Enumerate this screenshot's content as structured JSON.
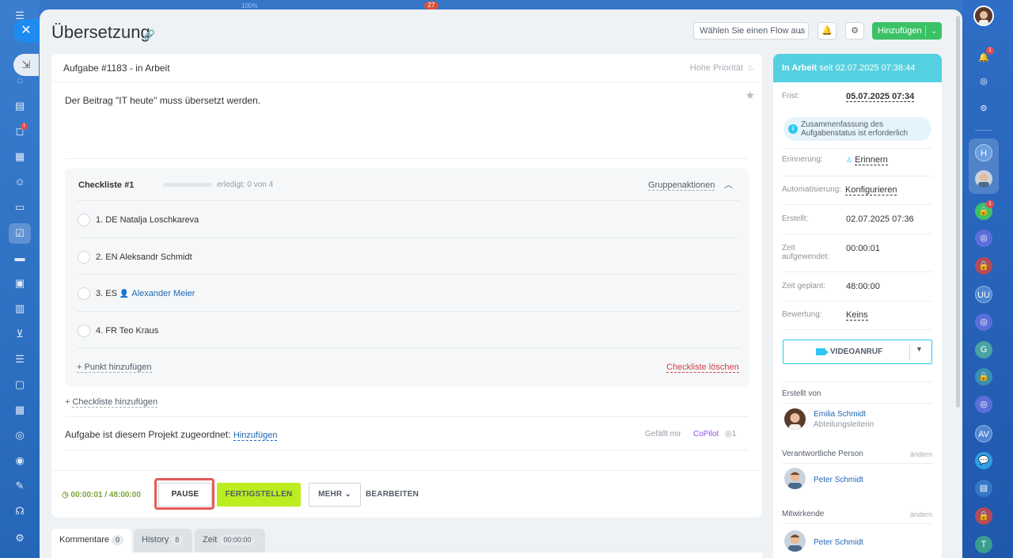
{
  "top_bar": {
    "zoom": "100%",
    "counter": "27"
  },
  "left_sidebar": {
    "icons": [
      "menu-icon",
      "close-icon",
      "pin-icon",
      "activity-icon",
      "feed-icon",
      "chat-icon",
      "calendar-icon",
      "contacts-icon",
      "documents-icon",
      "tasks-icon",
      "crm-icon",
      "projects-icon",
      "analytics-icon",
      "shop-icon",
      "sales-icon",
      "marketing-icon",
      "sites-icon",
      "automation-icon",
      "target-icon",
      "signature-icon",
      "headset-icon",
      "settings-icon"
    ],
    "chat_badge": "1"
  },
  "header": {
    "title": "Übersetzung",
    "flow_select": "Wählen Sie einen Flow aus",
    "add_button": "Hinzufügen"
  },
  "task": {
    "heading": "Aufgabe #1183 - in Arbeit",
    "priority": "Hohe Priorität",
    "description": "Der Beitrag \"IT heute\" muss übersetzt werden."
  },
  "checklist": {
    "title": "Checkliste #1",
    "progress": 0,
    "done_text": "erledigt: 0 von 4",
    "group_actions": "Gruppenaktionen",
    "items": [
      {
        "text": "1. DE Natalja Loschkareva"
      },
      {
        "text": "2. EN Aleksandr Schmidt"
      },
      {
        "text": "3. ES",
        "person": "Alexander Meier"
      },
      {
        "text": "4. FR Teo Kraus"
      }
    ],
    "add_item": "+ Punkt hinzufügen",
    "delete": "Checkliste löschen"
  },
  "add_checklist": {
    "prefix": "+ ",
    "label": "Checkliste hinzufügen"
  },
  "project": {
    "text": "Aufgabe ist diesem Projekt zugeordnet:",
    "link": "Hinzufügen",
    "likes": "Gefällt mir",
    "copilot": "CoPilot",
    "views": "1"
  },
  "footer": {
    "timer": "00:00:01 / 48:00:00",
    "pause": "PAUSE",
    "finish": "FERTIGSTELLEN",
    "more": "MEHR",
    "edit": "BEARBEITEN"
  },
  "tabs": [
    {
      "label": "Kommentare",
      "count": "0"
    },
    {
      "label": "History",
      "count": "8"
    },
    {
      "label": "Zeit",
      "count": "00:00:00"
    }
  ],
  "status_panel": {
    "status": "In Arbeit",
    "since": "seit 02.07.2025 07:38:44",
    "deadline_label": "Frist:",
    "deadline_value": "05.07.2025 07:34",
    "notice": "Zusammenfassung des Aufgabenstatus ist erforderlich",
    "reminder_label": "Erinnerung:",
    "reminder_value": "Erinnern",
    "automation_label": "Automatisierung:",
    "automation_value": "Konfigurieren",
    "created_label": "Erstellt:",
    "created_value": "02.07.2025 07:36",
    "spent_label": "Zeit aufgewendet:",
    "spent_value": "00:00:01",
    "planned_label": "Zeit geplant:",
    "planned_value": "48:00:00",
    "rating_label": "Bewertung:",
    "rating_value": "Keins",
    "video_button": "VIDEOANRUF",
    "created_by_title": "Erstellt von",
    "creator_name": "Emilia Schmidt",
    "creator_role": "Abteilungsleiterin",
    "responsible_title": "Verantwortliche Person",
    "change": "ändern",
    "responsible_name": "Peter Schmidt",
    "participants_title": "Mitwirkende",
    "participant_name": "Peter Schmidt"
  },
  "right_bar": {
    "items": [
      {
        "icon": "H",
        "color": "#5b8fd9"
      },
      {
        "icon": "G",
        "color": "#4aa3a3"
      },
      {
        "icon": "UU",
        "color": "#4f86d1"
      },
      {
        "icon": "AV",
        "color": "#4f86d1"
      },
      {
        "icon": "T",
        "color": "#3a9e8f"
      }
    ],
    "notification_badge": "1",
    "lock_badge": "1"
  },
  "colors": {
    "accent_green": "#3bc267",
    "status_cyan": "#55d0e0",
    "finish_lime": "#bbed21",
    "link_blue": "#2067b0"
  }
}
